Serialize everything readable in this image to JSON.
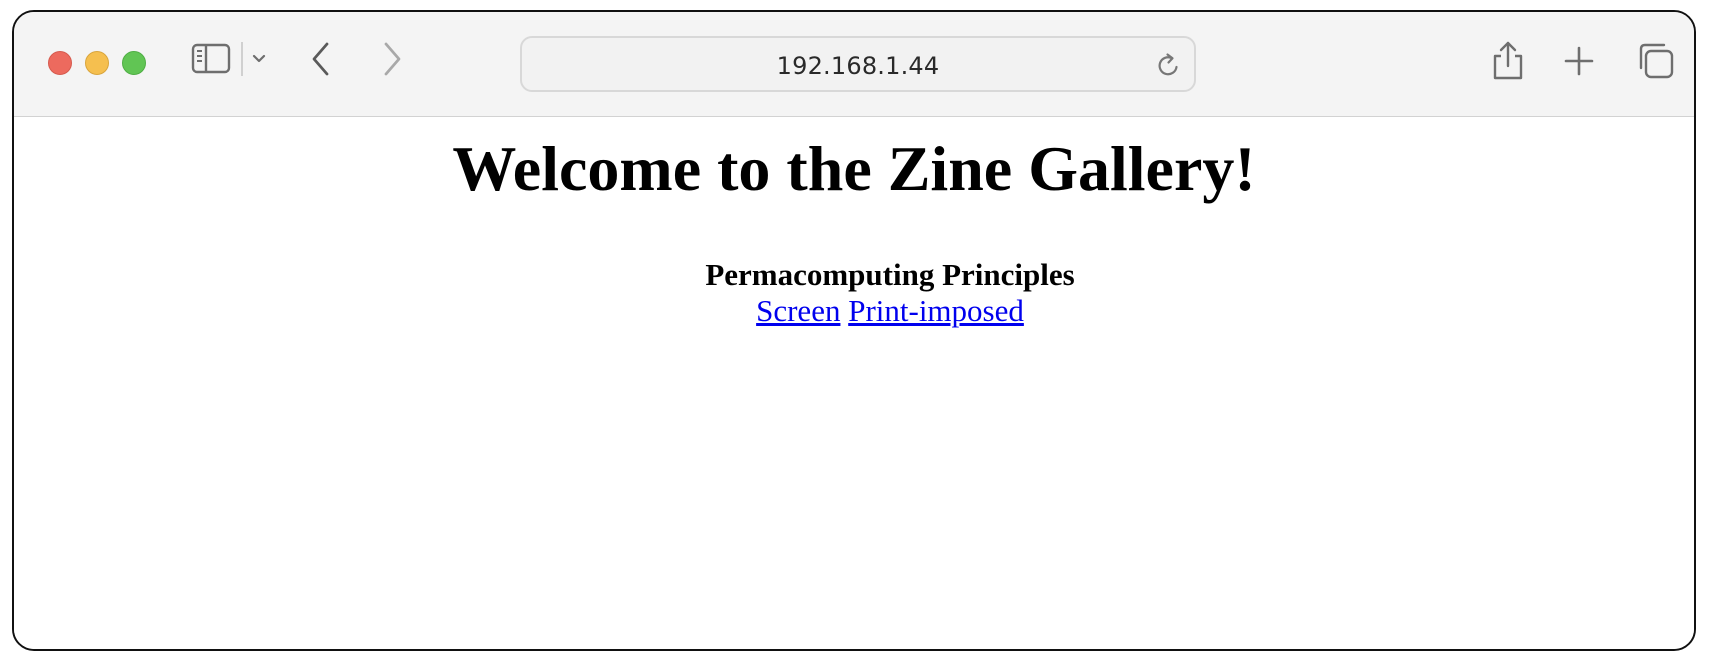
{
  "browser": {
    "url": "192.168.1.44",
    "icons": {
      "sidebar": "sidebar-icon",
      "sidebar_menu": "chevron-down-icon",
      "back": "chevron-left-icon",
      "forward": "chevron-right-icon",
      "reload": "reload-icon",
      "share": "share-icon",
      "new_tab": "plus-icon",
      "tabs": "tabs-overview-icon"
    },
    "traffic_lights": {
      "close": "#ed6a5e",
      "minimize": "#f5bf4f",
      "zoom": "#61c554"
    }
  },
  "page": {
    "heading": "Welcome to the Zine Gallery!",
    "zines": [
      {
        "title": "Permacomputing Principles",
        "links": [
          "Screen",
          "Print-imposed"
        ]
      }
    ],
    "link_color": "#0000ee"
  }
}
